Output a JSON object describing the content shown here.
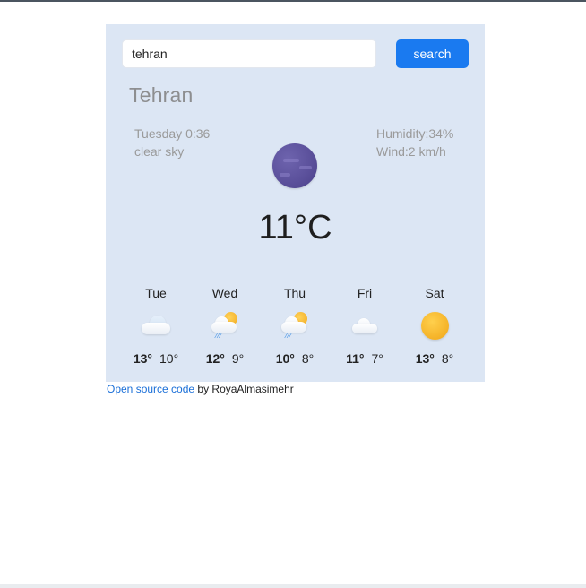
{
  "search": {
    "value": "tehran",
    "button_label": "search"
  },
  "current": {
    "city": "Tehran",
    "datetime": "Tuesday 0:36",
    "description": "clear sky",
    "humidity": "Humidity:34%",
    "wind": "Wind:2 km/h",
    "temperature": "11°C",
    "icon": "moon-icon"
  },
  "forecast": [
    {
      "day": "Tue",
      "max": "13°",
      "min": "10°",
      "icon": "cloud-icon"
    },
    {
      "day": "Wed",
      "max": "12°",
      "min": "9°",
      "icon": "sun-cloud-rain-icon"
    },
    {
      "day": "Thu",
      "max": "10°",
      "min": "8°",
      "icon": "sun-cloud-rain-icon"
    },
    {
      "day": "Fri",
      "max": "11°",
      "min": "7°",
      "icon": "cloud-icon"
    },
    {
      "day": "Sat",
      "max": "13°",
      "min": "8°",
      "icon": "sun-icon"
    }
  ],
  "footer": {
    "link_text": "Open source code",
    "author_text": " by RoyaAlmasimehr"
  },
  "colors": {
    "card_bg": "#dce6f4",
    "button_bg": "#1a7af0",
    "link": "#1a6fd8"
  }
}
